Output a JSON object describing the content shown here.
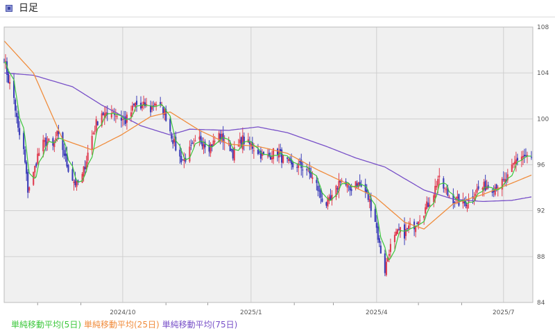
{
  "header": {
    "title": "日足",
    "icon": "window-icon"
  },
  "colors": {
    "up": "#e03c50",
    "down": "#3a3cb8",
    "sma5": "#3cc83c",
    "sma25": "#f08c3c",
    "sma75": "#7850c8",
    "grid": "#cfcfcf",
    "plot_bg": "#f0f0f0"
  },
  "chart_data": {
    "type": "candlestick",
    "title": "日足",
    "ylim": [
      84,
      108
    ],
    "y_ticks": [
      84,
      88,
      92,
      96,
      100,
      104,
      108
    ],
    "y_axis_position": "right",
    "x_tick_labels": [
      "2024/10",
      "2025/1",
      "2025/4",
      "2025/7"
    ],
    "grid": true,
    "legend": "bottom-left",
    "start_date": "2024-07-08",
    "price_anchors": [
      [
        "2024-07-08",
        105.3
      ],
      [
        "2024-07-11",
        103.4
      ],
      [
        "2024-07-15",
        101.8
      ],
      [
        "2024-07-18",
        99.0
      ],
      [
        "2024-07-22",
        97.2
      ],
      [
        "2024-07-25",
        93.8
      ],
      [
        "2024-07-29",
        95.2
      ],
      [
        "2024-08-01",
        96.8
      ],
      [
        "2024-08-05",
        97.8
      ],
      [
        "2024-08-08",
        98.0
      ],
      [
        "2024-08-12",
        97.5
      ],
      [
        "2024-08-15",
        98.6
      ],
      [
        "2024-08-19",
        97.4
      ],
      [
        "2024-08-22",
        96.0
      ],
      [
        "2024-08-26",
        94.8
      ],
      [
        "2024-08-29",
        94.2
      ],
      [
        "2024-09-02",
        95.0
      ],
      [
        "2024-09-05",
        96.5
      ],
      [
        "2024-09-09",
        98.5
      ],
      [
        "2024-09-12",
        99.6
      ],
      [
        "2024-09-16",
        100.6
      ],
      [
        "2024-09-19",
        100.2
      ],
      [
        "2024-09-23",
        100.8
      ],
      [
        "2024-09-26",
        100.4
      ],
      [
        "2024-09-30",
        100.0
      ],
      [
        "2024-10-03",
        99.8
      ],
      [
        "2024-10-07",
        100.6
      ],
      [
        "2024-10-10",
        101.3
      ],
      [
        "2024-10-14",
        100.9
      ],
      [
        "2024-10-17",
        101.2
      ],
      [
        "2024-10-21",
        100.8
      ],
      [
        "2024-10-24",
        101.5
      ],
      [
        "2024-10-28",
        101.0
      ],
      [
        "2024-10-31",
        100.6
      ],
      [
        "2024-11-04",
        99.0
      ],
      [
        "2024-11-07",
        97.8
      ],
      [
        "2024-11-11",
        96.6
      ],
      [
        "2024-11-14",
        96.4
      ],
      [
        "2024-11-18",
        97.2
      ],
      [
        "2024-11-21",
        97.6
      ],
      [
        "2024-11-25",
        98.2
      ],
      [
        "2024-11-28",
        98.0
      ],
      [
        "2024-12-02",
        97.6
      ],
      [
        "2024-12-05",
        97.9
      ],
      [
        "2024-12-09",
        98.6
      ],
      [
        "2024-12-12",
        98.2
      ],
      [
        "2024-12-16",
        97.8
      ],
      [
        "2024-12-19",
        97.0
      ],
      [
        "2024-12-23",
        97.6
      ],
      [
        "2024-12-26",
        98.2
      ],
      [
        "2024-12-30",
        97.8
      ],
      [
        "2025-01-02",
        97.6
      ],
      [
        "2025-01-06",
        97.2
      ],
      [
        "2025-01-09",
        96.8
      ],
      [
        "2025-01-13",
        96.6
      ],
      [
        "2025-01-16",
        97.0
      ],
      [
        "2025-01-20",
        97.2
      ],
      [
        "2025-01-23",
        96.6
      ],
      [
        "2025-01-27",
        96.2
      ],
      [
        "2025-01-30",
        95.8
      ],
      [
        "2025-02-03",
        96.0
      ],
      [
        "2025-02-06",
        95.8
      ],
      [
        "2025-02-10",
        95.6
      ],
      [
        "2025-02-13",
        95.0
      ],
      [
        "2025-02-17",
        94.2
      ],
      [
        "2025-02-20",
        93.2
      ],
      [
        "2025-02-24",
        92.6
      ],
      [
        "2025-02-27",
        92.8
      ],
      [
        "2025-03-03",
        93.8
      ],
      [
        "2025-03-06",
        94.8
      ],
      [
        "2025-03-10",
        94.2
      ],
      [
        "2025-03-13",
        93.8
      ],
      [
        "2025-03-17",
        94.6
      ],
      [
        "2025-03-20",
        94.2
      ],
      [
        "2025-03-24",
        93.6
      ],
      [
        "2025-03-27",
        92.8
      ],
      [
        "2025-03-31",
        91.2
      ],
      [
        "2025-04-03",
        89.0
      ],
      [
        "2025-04-07",
        86.8
      ],
      [
        "2025-04-10",
        88.6
      ],
      [
        "2025-04-14",
        89.6
      ],
      [
        "2025-04-17",
        90.2
      ],
      [
        "2025-04-21",
        90.0
      ],
      [
        "2025-04-24",
        90.5
      ],
      [
        "2025-04-28",
        90.8
      ],
      [
        "2025-05-01",
        91.4
      ],
      [
        "2025-05-05",
        92.0
      ],
      [
        "2025-05-08",
        92.6
      ],
      [
        "2025-05-12",
        93.6
      ],
      [
        "2025-05-15",
        94.8
      ],
      [
        "2025-05-19",
        94.0
      ],
      [
        "2025-05-22",
        93.4
      ],
      [
        "2025-05-26",
        93.0
      ],
      [
        "2025-05-29",
        92.8
      ],
      [
        "2025-06-02",
        92.6
      ],
      [
        "2025-06-05",
        92.8
      ],
      [
        "2025-06-09",
        93.4
      ],
      [
        "2025-06-12",
        93.8
      ],
      [
        "2025-06-16",
        94.0
      ],
      [
        "2025-06-19",
        94.2
      ],
      [
        "2025-06-23",
        94.0
      ],
      [
        "2025-06-26",
        94.2
      ],
      [
        "2025-06-30",
        94.4
      ],
      [
        "2025-07-03",
        94.6
      ],
      [
        "2025-07-07",
        95.6
      ],
      [
        "2025-07-10",
        96.4
      ],
      [
        "2025-07-14",
        96.8
      ],
      [
        "2025-07-17",
        96.7
      ],
      [
        "2025-07-21",
        96.5
      ]
    ],
    "sma_anchors": {
      "sma25": [
        [
          "2024-07-08",
          106.8
        ],
        [
          "2024-07-29",
          104.0
        ],
        [
          "2024-08-19",
          98.2
        ],
        [
          "2024-09-09",
          97.3
        ],
        [
          "2024-09-30",
          98.6
        ],
        [
          "2024-10-21",
          100.2
        ],
        [
          "2024-11-04",
          100.6
        ],
        [
          "2024-11-25",
          99.0
        ],
        [
          "2024-12-16",
          97.8
        ],
        [
          "2025-01-06",
          97.6
        ],
        [
          "2025-01-27",
          97.0
        ],
        [
          "2025-02-17",
          95.6
        ],
        [
          "2025-03-10",
          94.4
        ],
        [
          "2025-03-31",
          93.2
        ],
        [
          "2025-04-21",
          91.0
        ],
        [
          "2025-05-05",
          90.4
        ],
        [
          "2025-05-26",
          92.6
        ],
        [
          "2025-06-16",
          93.4
        ],
        [
          "2025-07-07",
          94.4
        ],
        [
          "2025-07-21",
          95.1
        ]
      ],
      "sma75": [
        [
          "2024-07-08",
          104.0
        ],
        [
          "2024-07-29",
          103.8
        ],
        [
          "2024-08-26",
          102.8
        ],
        [
          "2024-09-16",
          101.2
        ],
        [
          "2024-10-14",
          99.4
        ],
        [
          "2024-11-04",
          98.6
        ],
        [
          "2024-11-18",
          99.1
        ],
        [
          "2024-12-16",
          99.0
        ],
        [
          "2025-01-06",
          99.3
        ],
        [
          "2025-01-27",
          98.8
        ],
        [
          "2025-02-24",
          97.6
        ],
        [
          "2025-03-17",
          96.6
        ],
        [
          "2025-04-07",
          95.8
        ],
        [
          "2025-05-05",
          93.8
        ],
        [
          "2025-05-26",
          93.0
        ],
        [
          "2025-06-16",
          92.8
        ],
        [
          "2025-07-07",
          92.9
        ],
        [
          "2025-07-21",
          93.2
        ]
      ]
    },
    "series": [
      {
        "name": "単純移動平均(5日)",
        "color": "#3cc83c"
      },
      {
        "name": "単純移動平均(25日)",
        "color": "#f08c3c"
      },
      {
        "name": "単純移動平均(75日)",
        "color": "#7850c8"
      }
    ]
  }
}
